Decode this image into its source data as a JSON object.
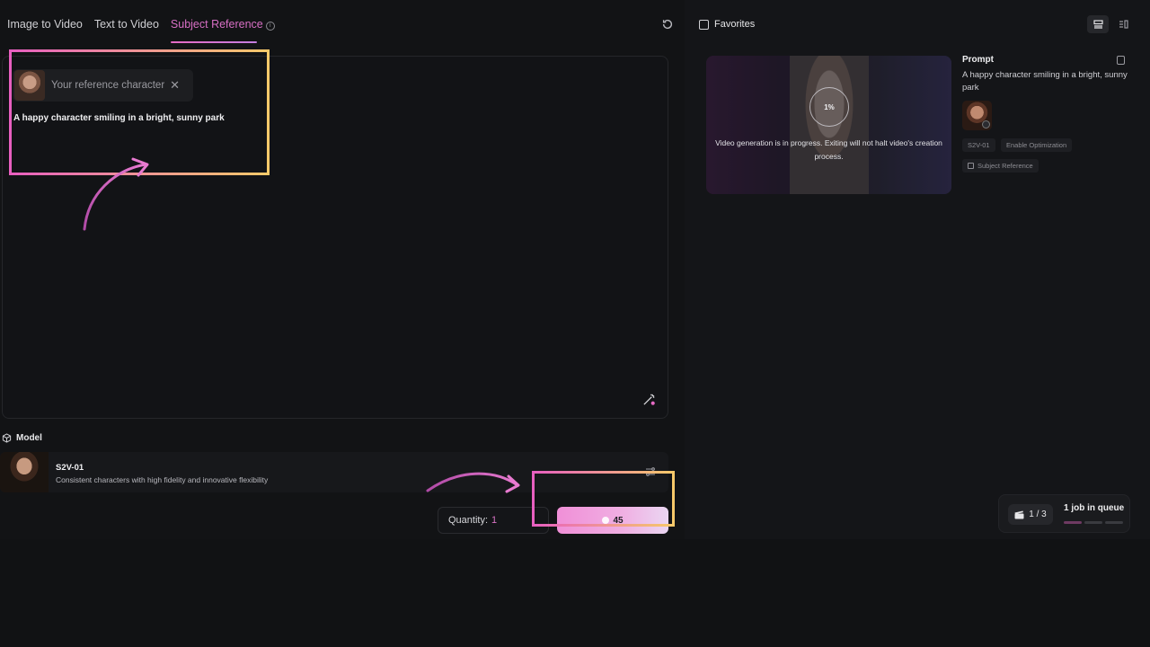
{
  "tabs": [
    {
      "label": "Image to Video",
      "active": false
    },
    {
      "label": "Text to Video",
      "active": false
    },
    {
      "label": "Subject Reference",
      "active": true
    }
  ],
  "tab_info_glyph": "i",
  "reference": {
    "placeholder": "Your reference character",
    "close_glyph": "✕"
  },
  "prompt": {
    "text": "A happy character smiling in a bright, sunny park"
  },
  "model": {
    "section_label": "Model",
    "name": "S2V-01",
    "description": "Consistent characters with high fidelity and innovative flexibility"
  },
  "quantity": {
    "label": "Quantity:",
    "value": "1"
  },
  "generate": {
    "cost": "45"
  },
  "favorites": {
    "label": "Favorites"
  },
  "job": {
    "progress_label": "1%",
    "progress": 0.01,
    "message": "Video generation is in progress. Exiting will not halt video's creation process.",
    "prompt_heading": "Prompt",
    "prompt_text": "A happy character smiling in a bright, sunny park",
    "tags": [
      "S2V-01",
      "Enable Optimization",
      "Subject Reference"
    ]
  },
  "queue": {
    "count": "1 / 3",
    "label": "1 job in queue"
  },
  "colors": {
    "accent": "#d76fc4",
    "highlight_start": "#e85fc0",
    "highlight_end": "#f6c96a",
    "background": "#111214"
  },
  "icons": [
    "info-icon",
    "refresh-icon",
    "close-icon",
    "enhance-icon",
    "cube-icon",
    "settings-icon",
    "coin-icon",
    "checkbox-icon",
    "grid-view-icon",
    "list-view-icon",
    "copy-icon",
    "clapper-icon"
  ]
}
